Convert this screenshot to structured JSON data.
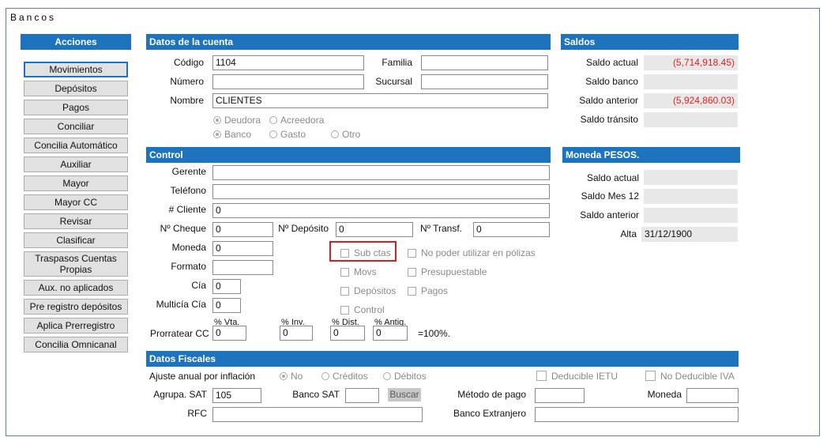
{
  "window_title": "Bancos",
  "acciones": {
    "header": "Acciones",
    "buttons": [
      "Movimientos",
      "Depósitos",
      "Pagos",
      "Conciliar",
      "Concilia Automático",
      "Auxiliar",
      "Mayor",
      "Mayor CC",
      "Revisar",
      "Clasificar",
      "Traspasos  Cuentas Propias",
      "Aux. no aplicados",
      "Pre registro depósitos",
      "Aplica Prerregistro",
      "Concilia Omnicanal"
    ],
    "selected": "Movimientos"
  },
  "cuenta": {
    "header": "Datos de la cuenta",
    "codigo_label": "Código",
    "codigo_value": "1104",
    "familia_label": "Familia",
    "familia_value": "",
    "numero_label": "Número",
    "numero_value": "",
    "sucursal_label": "Sucursal",
    "sucursal_value": "",
    "nombre_label": "Nombre",
    "nombre_value": "CLIENTES",
    "naturaleza_options": [
      "Deudora",
      "Acreedora"
    ],
    "naturaleza_selected": "Deudora",
    "tipo_options": [
      "Banco",
      "Gasto",
      "Otro"
    ],
    "tipo_selected": "Banco"
  },
  "saldos": {
    "header": "Saldos",
    "saldo_actual_label": "Saldo actual",
    "saldo_actual": "(5,714,918.45)",
    "saldo_banco_label": "Saldo banco",
    "saldo_banco": "",
    "saldo_anterior_label": "Saldo anterior",
    "saldo_anterior": "(5,924,860.03)",
    "saldo_transito_label": "Saldo tránsito",
    "saldo_transito": ""
  },
  "control": {
    "header": "Control",
    "gerente_label": "Gerente",
    "gerente_value": "",
    "telefono_label": "Teléfono",
    "telefono_value": "",
    "cliente_label": "# Cliente",
    "cliente_value": "0",
    "cheque_label": "Nº Cheque",
    "cheque_value": "0",
    "deposito_label": "Nº Depósito",
    "deposito_value": "0",
    "transf_label": "Nº Transf.",
    "transf_value": "0",
    "moneda_label": "Moneda",
    "moneda_value": "0",
    "formato_label": "Formato",
    "formato_value": "",
    "cia_label": "Cía",
    "cia_value": "0",
    "multicia_label": "Multicía Cía",
    "multicia_value": "0",
    "checks": {
      "sub_ctas": "Sub ctas",
      "movs": "Movs",
      "depositos": "Depósitos",
      "control": "Control",
      "no_poder": "No poder utilizar en pólizas",
      "presupuestable": "Presupuestable",
      "pagos": "Pagos"
    },
    "prorratear_label": "Prorratear CC",
    "vta_label": "% Vta.",
    "vta_value": "0",
    "inv_label": "% Inv.",
    "inv_value": "0",
    "dist_label": "% Dist.",
    "dist_value": "0",
    "antig_label": "% Antig.",
    "antig_value": "0",
    "total_text": "=100%."
  },
  "moneda": {
    "header": "Moneda PESOS.",
    "saldo_actual_label": "Saldo actual",
    "saldo_actual": "",
    "saldo_mes_label": "Saldo Mes 12",
    "saldo_mes": "",
    "saldo_anterior_label": "Saldo anterior",
    "saldo_anterior": "",
    "alta_label": "Alta",
    "alta": "31/12/1900"
  },
  "fiscales": {
    "header": "Datos Fiscales",
    "ajuste_label": "Ajuste anual por inflación",
    "ajuste_options": [
      "No",
      "Créditos",
      "Débitos"
    ],
    "ajuste_selected": "No",
    "deducible_ietu": "Deducible IETU",
    "no_deducible_iva": "No Deducible IVA",
    "agrupa_label": "Agrupa. SAT",
    "agrupa_value": "105",
    "banco_sat_label": "Banco SAT",
    "banco_sat_value": "",
    "buscar_label": "Buscar",
    "metodo_label": "Método de pago",
    "metodo_value": "",
    "moneda_label": "Moneda",
    "moneda_value": "",
    "rfc_label": "RFC",
    "rfc_value": "",
    "banco_ext_label": "Banco Extranjero",
    "banco_ext_value": ""
  },
  "colors": {
    "header_bg": "#1e73be",
    "negative": "#e0201f",
    "highlight": "#d81e1e"
  }
}
